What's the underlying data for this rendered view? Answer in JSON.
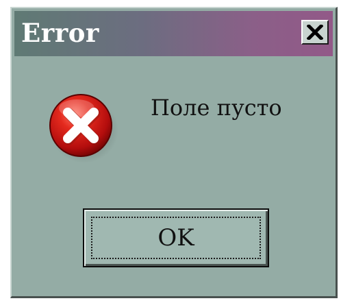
{
  "window": {
    "title": "Error"
  },
  "titlebar": {
    "close_icon": "close-icon"
  },
  "content": {
    "icon": "error-icon",
    "message": "Поле пусто"
  },
  "buttons": {
    "ok_label": "OK"
  },
  "colors": {
    "dialog_background": "#94aca5",
    "titlebar_start": "#5f7a74",
    "titlebar_end": "#925988",
    "error_red": "#d81818"
  }
}
